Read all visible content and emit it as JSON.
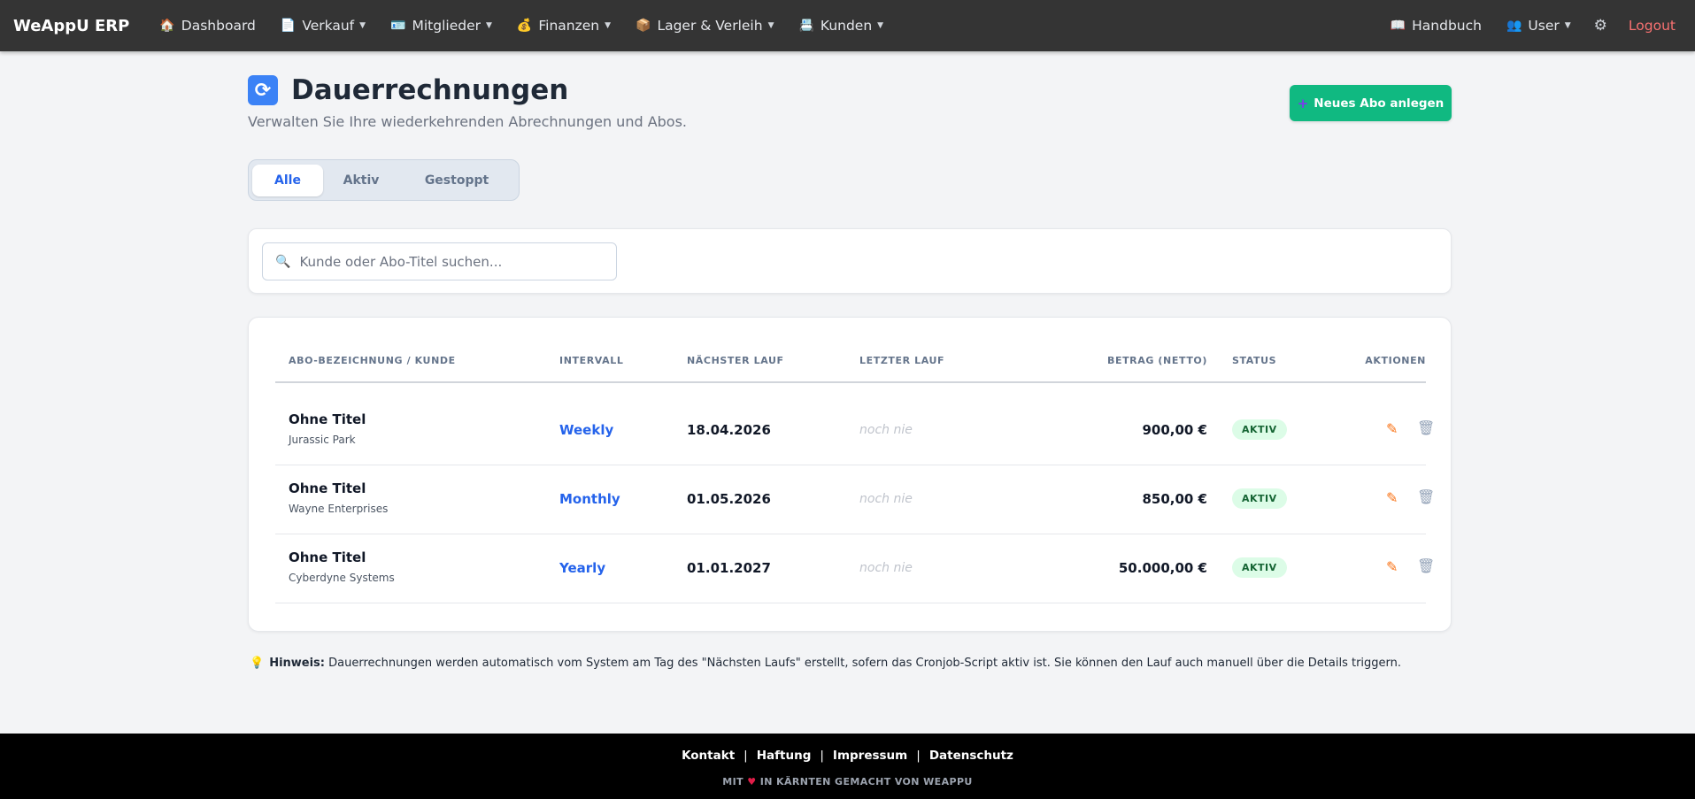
{
  "navbar": {
    "brand": "WeAppU ERP",
    "items": [
      {
        "label": "Dashboard",
        "icon": "🏠",
        "dropdown": false
      },
      {
        "label": "Verkauf",
        "icon": "📄",
        "dropdown": true
      },
      {
        "label": "Mitglieder",
        "icon": "🪪",
        "dropdown": true
      },
      {
        "label": "Finanzen",
        "icon": "💰",
        "dropdown": true
      },
      {
        "label": "Lager & Verleih",
        "icon": "📦",
        "dropdown": true
      },
      {
        "label": "Kunden",
        "icon": "📇",
        "dropdown": true
      }
    ],
    "handbuch": {
      "label": "Handbuch",
      "icon": "📖"
    },
    "user": {
      "label": "User",
      "icon": "👥"
    },
    "settings_icon": "gear-icon",
    "logout": "Logout"
  },
  "header": {
    "icon": "🔄",
    "title": "Dauerrechnungen",
    "subtitle": "Verwalten Sie Ihre wiederkehrenden Abrechnungen und Abos."
  },
  "new_button": {
    "icon": "+",
    "label": "Neues Abo anlegen"
  },
  "tabs": [
    {
      "label": "Alle",
      "active": true
    },
    {
      "label": "Aktiv",
      "active": false
    },
    {
      "label": "Gestoppt",
      "active": false
    }
  ],
  "search": {
    "icon": "🔍",
    "placeholder": "Kunde oder Abo-Titel suchen..."
  },
  "table": {
    "columns": [
      "ABO-BEZEICHNUNG / KUNDE",
      "INTERVALL",
      "NÄCHSTER LAUF",
      "LETZTER LAUF",
      "BETRAG (NETTO)",
      "STATUS",
      "AKTIONEN"
    ],
    "rows": [
      {
        "title": "Ohne Titel",
        "customer": "Jurassic Park",
        "interval": "Weekly",
        "next": "18.04.2026",
        "last": "noch nie",
        "amount": "900,00 €",
        "status": "AKTIV"
      },
      {
        "title": "Ohne Titel",
        "customer": "Wayne Enterprises",
        "interval": "Monthly",
        "next": "01.05.2026",
        "last": "noch nie",
        "amount": "850,00 €",
        "status": "AKTIV"
      },
      {
        "title": "Ohne Titel",
        "customer": "Cyberdyne Systems",
        "interval": "Yearly",
        "next": "01.01.2027",
        "last": "noch nie",
        "amount": "50.000,00 €",
        "status": "AKTIV"
      }
    ]
  },
  "hint": {
    "icon": "💡",
    "label": "Hinweis:",
    "text": "Dauerrechnungen werden automatisch vom System am Tag des \"Nächsten Laufs\" erstellt, sofern das Cronjob-Script aktiv ist. Sie können den Lauf auch manuell über die Details triggern."
  },
  "footer": {
    "links": [
      "Kontakt",
      "Haftung",
      "Impressum",
      "Datenschutz"
    ],
    "made_prefix": "MIT",
    "heart": "♥",
    "made_suffix": "IN KÄRNTEN GEMACHT VON WEAPPU"
  },
  "colors": {
    "navbar": "#343434",
    "accent_green": "#10b981",
    "accent_blue": "#2563eb",
    "logout_red": "#f87171",
    "status_bg": "#dcfce7",
    "status_text": "#166534"
  }
}
